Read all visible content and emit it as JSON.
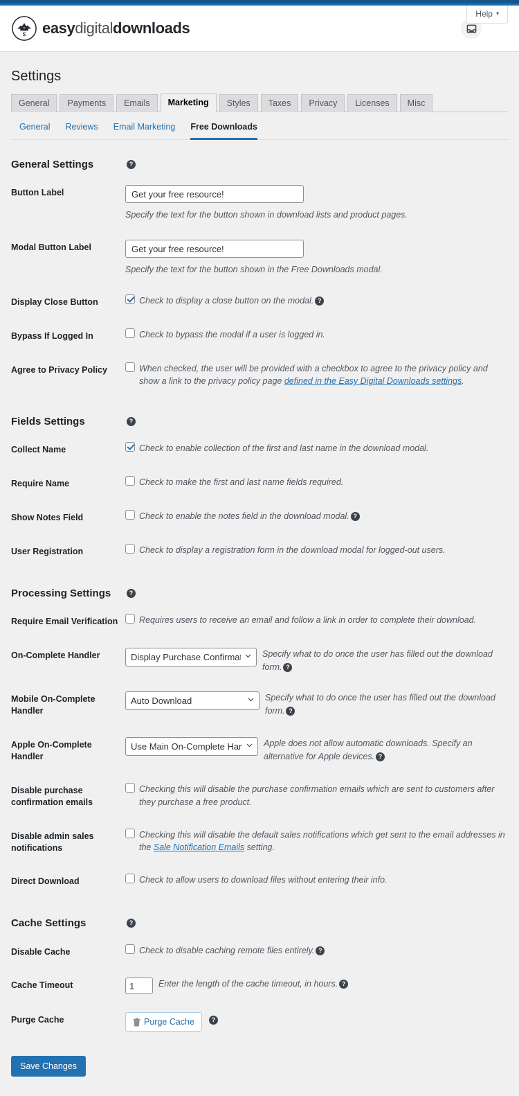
{
  "topbar": {
    "dark_color": "#14568a",
    "blue_color": "#1f6fb2"
  },
  "masthead": {
    "brand_easy": "easy",
    "brand_digital": "digital",
    "brand_downloads": "downloads",
    "inbox_icon": "inbox-icon",
    "help_label": "Help",
    "help_caret": "▾"
  },
  "page": {
    "title": "Settings"
  },
  "tabs": [
    {
      "label": "General",
      "active": false
    },
    {
      "label": "Payments",
      "active": false
    },
    {
      "label": "Emails",
      "active": false
    },
    {
      "label": "Marketing",
      "active": true
    },
    {
      "label": "Styles",
      "active": false
    },
    {
      "label": "Taxes",
      "active": false
    },
    {
      "label": "Privacy",
      "active": false
    },
    {
      "label": "Licenses",
      "active": false
    },
    {
      "label": "Misc",
      "active": false
    }
  ],
  "subtabs": [
    {
      "label": "General",
      "active": false
    },
    {
      "label": "Reviews",
      "active": false
    },
    {
      "label": "Email Marketing",
      "active": false
    },
    {
      "label": "Free Downloads",
      "active": true
    }
  ],
  "sections": {
    "general": {
      "heading": "General Settings",
      "button_label": {
        "label": "Button Label",
        "value": "Get your free resource!",
        "desc": "Specify the text for the button shown in download lists and product pages."
      },
      "modal_button_label": {
        "label": "Modal Button Label",
        "value": "Get your free resource!",
        "desc": "Specify the text for the button shown in the Free Downloads modal."
      },
      "display_close_button": {
        "label": "Display Close Button",
        "desc": "Check to display a close button on the modal.",
        "checked": true
      },
      "bypass_if_logged_in": {
        "label": "Bypass If Logged In",
        "desc": "Check to bypass the modal if a user is logged in.",
        "checked": false
      },
      "agree_privacy": {
        "label": "Agree to Privacy Policy",
        "desc_part1": "When checked, the user will be provided with a checkbox to agree to the privacy policy and show a link to the privacy policy page ",
        "link_text": "defined in the Easy Digital Downloads settings",
        "desc_part2": ".",
        "checked": false
      }
    },
    "fields": {
      "heading": "Fields Settings",
      "collect_name": {
        "label": "Collect Name",
        "desc": "Check to enable collection of the first and last name in the download modal.",
        "checked": true
      },
      "require_name": {
        "label": "Require Name",
        "desc": "Check to make the first and last name fields required.",
        "checked": false
      },
      "show_notes_field": {
        "label": "Show Notes Field",
        "desc": "Check to enable the notes field in the download modal.",
        "checked": false
      },
      "user_registration": {
        "label": "User Registration",
        "desc": "Check to display a registration form in the download modal for logged-out users.",
        "checked": false
      }
    },
    "processing": {
      "heading": "Processing Settings",
      "require_email_verification": {
        "label": "Require Email Verification",
        "desc": "Requires users to receive an email and follow a link in order to complete their download.",
        "checked": false
      },
      "on_complete_handler": {
        "label": "On-Complete Handler",
        "value": "Display Purchase Confirmation",
        "desc": "Specify what to do once the user has filled out the download form."
      },
      "mobile_on_complete_handler": {
        "label": "Mobile On-Complete Handler",
        "value": "Auto Download",
        "desc": "Specify what to do once the user has filled out the download form."
      },
      "apple_on_complete_handler": {
        "label": "Apple On-Complete Handler",
        "value": "Use Main On-Complete Handler",
        "desc": "Apple does not allow automatic downloads. Specify an alternative for Apple devices."
      },
      "disable_purchase_confirmation_emails": {
        "label": "Disable purchase confirmation emails",
        "desc": "Checking this will disable the purchase confirmation emails which are sent to customers after they purchase a free product.",
        "checked": false
      },
      "disable_admin_sales_notifications": {
        "label": "Disable admin sales notifications",
        "desc_part1": "Checking this will disable the default sales notifications which get sent to the email addresses in the ",
        "link_text": "Sale Notification Emails",
        "desc_part2": " setting.",
        "checked": false
      },
      "direct_download": {
        "label": "Direct Download",
        "desc": "Check to allow users to download files without entering their info.",
        "checked": false
      }
    },
    "cache": {
      "heading": "Cache Settings",
      "disable_cache": {
        "label": "Disable Cache",
        "desc": "Check to disable caching remote files entirely.",
        "checked": false
      },
      "cache_timeout": {
        "label": "Cache Timeout",
        "value": "1",
        "desc": "Enter the length of the cache timeout, in hours."
      },
      "purge_cache": {
        "label": "Purge Cache",
        "button_label": "Purge Cache",
        "icon": "trash-icon"
      }
    }
  },
  "footer": {
    "save_label": "Save Changes"
  },
  "help_icon_glyph": "?"
}
